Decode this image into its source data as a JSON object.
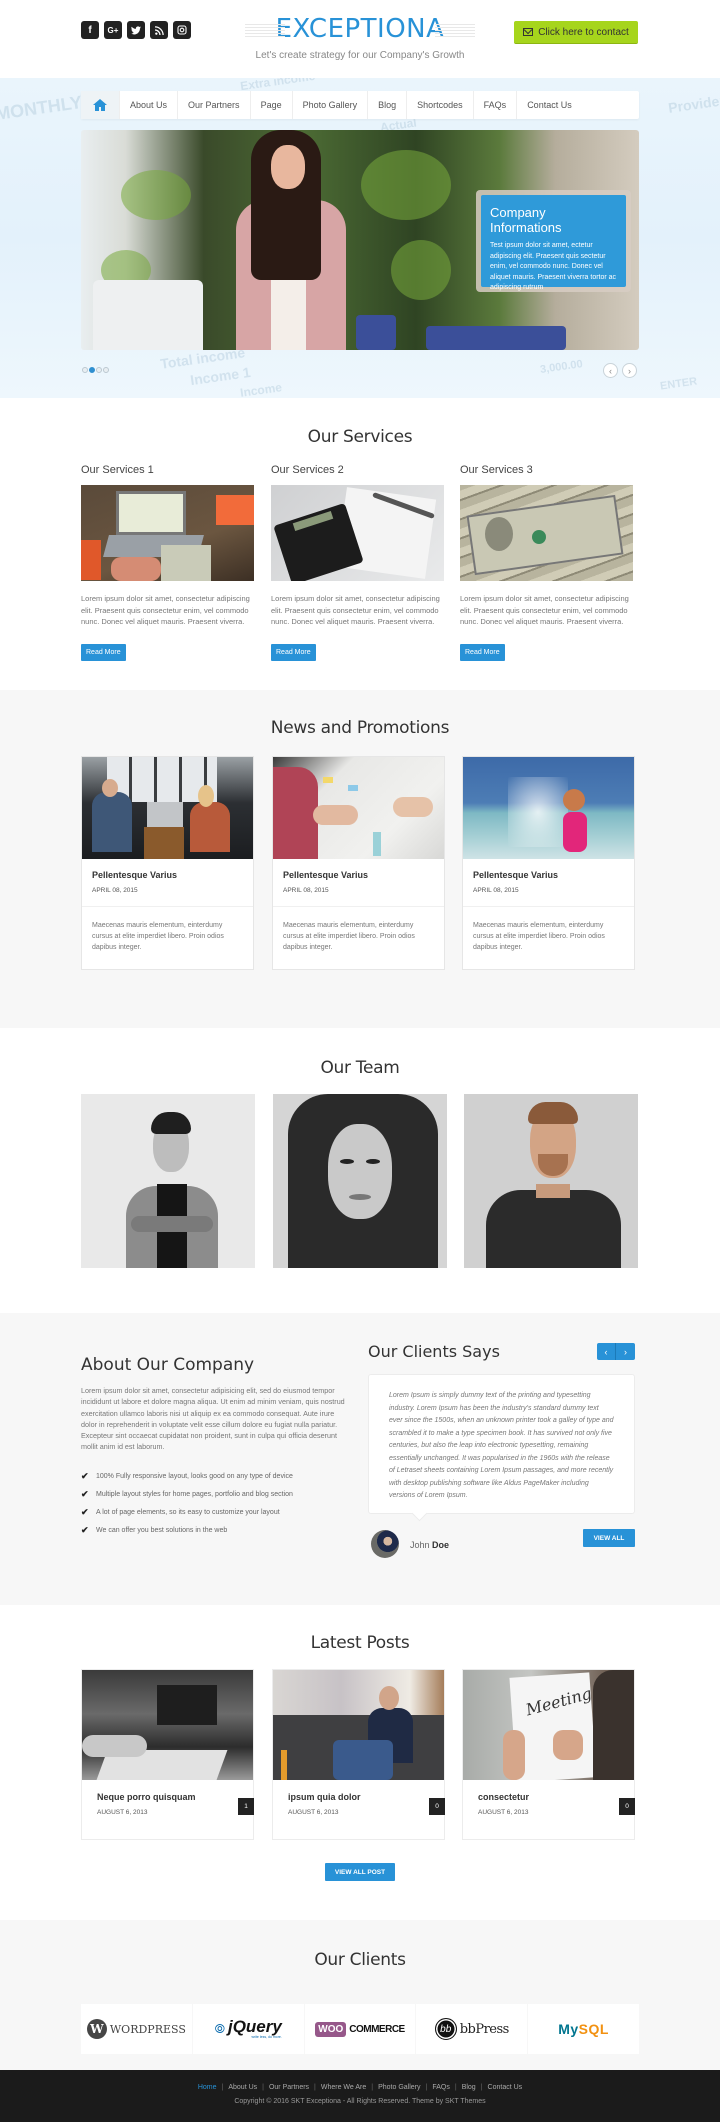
{
  "header": {
    "social_icons": [
      {
        "name": "facebook-icon",
        "glyph": "f"
      },
      {
        "name": "google-plus-icon",
        "glyph": "G+"
      },
      {
        "name": "twitter-icon",
        "glyph": "t"
      },
      {
        "name": "rss-icon",
        "glyph": "◔"
      },
      {
        "name": "instagram-icon",
        "glyph": "▣"
      }
    ],
    "logo": "EXCEPTIONA",
    "tagline": "Let's create strategy for our Company's Growth",
    "contact_button": "Click here to contact",
    "brand_color": "#2892d7",
    "contact_color": "#a6d51c"
  },
  "nav": {
    "items": [
      "About Us",
      "Our Partners",
      "Page",
      "Photo Gallery",
      "Blog",
      "Shortcodes",
      "FAQs",
      "Contact Us"
    ]
  },
  "hero": {
    "bg_words": [
      "MONTHLY",
      "Extra income",
      "Total income",
      "Income 1",
      "Income",
      "3,000.00",
      "ENTER",
      "Provider",
      "Actual"
    ],
    "slide_title": "Company Informations",
    "slide_text": "Test ipsum dolor sit amet, ectetur adipiscing elit. Praesent quis sectetur enim, vel commodo nunc. Donec vel aliquet mauris. Praesent viverra tortor ac adipiscing rutrum",
    "slide_count": 4,
    "active_slide": 2,
    "prev_arrow": "‹",
    "next_arrow": "›"
  },
  "services": {
    "title": "Our Services",
    "items": [
      {
        "title": "Our Services 1",
        "text": "Lorem ipsum dolor sit amet, consectetur adipiscing elit. Praesent quis consectetur enim, vel commodo nunc. Donec vel aliquet mauris. Praesent viverra.",
        "button": "Read More"
      },
      {
        "title": "Our Services 2",
        "text": "Lorem ipsum dolor sit amet, consectetur adipiscing elit. Praesent quis consectetur enim, vel commodo nunc. Donec vel aliquet mauris. Praesent viverra.",
        "button": "Read More"
      },
      {
        "title": "Our Services 3",
        "text": "Lorem ipsum dolor sit amet, consectetur adipiscing elit. Praesent quis consectetur enim, vel commodo nunc. Donec vel aliquet mauris. Praesent viverra.",
        "button": "Read More"
      }
    ]
  },
  "news": {
    "title": "News and Promotions",
    "items": [
      {
        "title": "Pellentesque Varius",
        "date": "APRIL 08, 2015",
        "text": "Maecenas mauris elementum, einterdumy cursus at elite imperdiet libero. Proin odios dapibus integer."
      },
      {
        "title": "Pellentesque Varius",
        "date": "APRIL 08, 2015",
        "text": "Maecenas mauris elementum, einterdumy cursus at elite imperdiet libero. Proin odios dapibus integer."
      },
      {
        "title": "Pellentesque Varius",
        "date": "APRIL 08, 2015",
        "text": "Maecenas mauris elementum, einterdumy cursus at elite imperdiet libero. Proin odios dapibus integer."
      }
    ]
  },
  "team": {
    "title": "Our Team"
  },
  "about": {
    "title": "About Our Company",
    "text": "Lorem ipsum dolor sit amet, consectetur adipisicing elit, sed do eiusmod tempor incididunt ut labore et dolore magna aliqua. Ut enim ad minim veniam, quis nostrud exercitation ullamco laboris nisi ut aliquip ex ea commodo consequat. Aute irure dolor in reprehenderit in voluptate velit esse cillum dolore eu fugiat nulla pariatur. Excepteur sint occaecat cupidatat non proident, sunt in culpa qui officia deserunt mollit anim id est laborum.",
    "features": [
      "100% Fully responsive layout, looks good on any type of device",
      "Multiple layout styles for home pages, portfolio and blog section",
      "A lot of page elements, so its easy to customize your layout",
      "We can offer you best solutions in the web"
    ],
    "check_glyph": "✔"
  },
  "testimonials": {
    "title": "Our Clients Says",
    "prev": "‹",
    "next": "›",
    "quote": "Lorem Ipsum is simply dummy text of the printing and typesetting industry. Lorem Ipsum has been the industry's standard dummy text ever since the 1500s, when an unknown printer took a galley of type and scrambled it to make a type specimen book. It has survived not only five centuries, but also the leap into electronic typesetting, remaining essentially unchanged. It was popularised in the 1960s with the release of Letraset sheets containing Lorem Ipsum passages, and more recently with desktop publishing software like Aldus PageMaker including versions of Lorem Ipsum.",
    "client_first": "John",
    "client_last": "Doe",
    "view_all": "VIEW ALL"
  },
  "posts": {
    "title": "Latest Posts",
    "items": [
      {
        "title": "Neque porro quisquam",
        "date": "AUGUST 6, 2013",
        "comments": "1"
      },
      {
        "title": "ipsum quia dolor",
        "date": "AUGUST 6, 2013",
        "comments": "0"
      },
      {
        "title": "consectetur",
        "date": "AUGUST 6, 2013",
        "comments": "0"
      }
    ],
    "view_all": "VIEW ALL POST"
  },
  "clients": {
    "title": "Our Clients",
    "logos": [
      {
        "name": "WordPress",
        "mark": "W",
        "text": "WORDPRESS"
      },
      {
        "name": "jQuery",
        "mark": "⦾",
        "text": "jQuery",
        "sub": "write less, do more."
      },
      {
        "name": "WooCommerce",
        "mark": "WOO",
        "text": "COMMERCE"
      },
      {
        "name": "bbPress",
        "mark": "bb",
        "text": "bbPress"
      },
      {
        "name": "MySQL",
        "text1": "My",
        "text2": "SQL"
      }
    ]
  },
  "footer": {
    "links": [
      "Home",
      "About Us",
      "Our Partners",
      "Where We Are",
      "Photo Gallery",
      "FAQs",
      "Blog",
      "Contact Us"
    ],
    "active_link": "Home",
    "copyright": "Copyright © 2016 SKT Exceptiona - All Rights Reserved. Theme by SKT Themes"
  }
}
